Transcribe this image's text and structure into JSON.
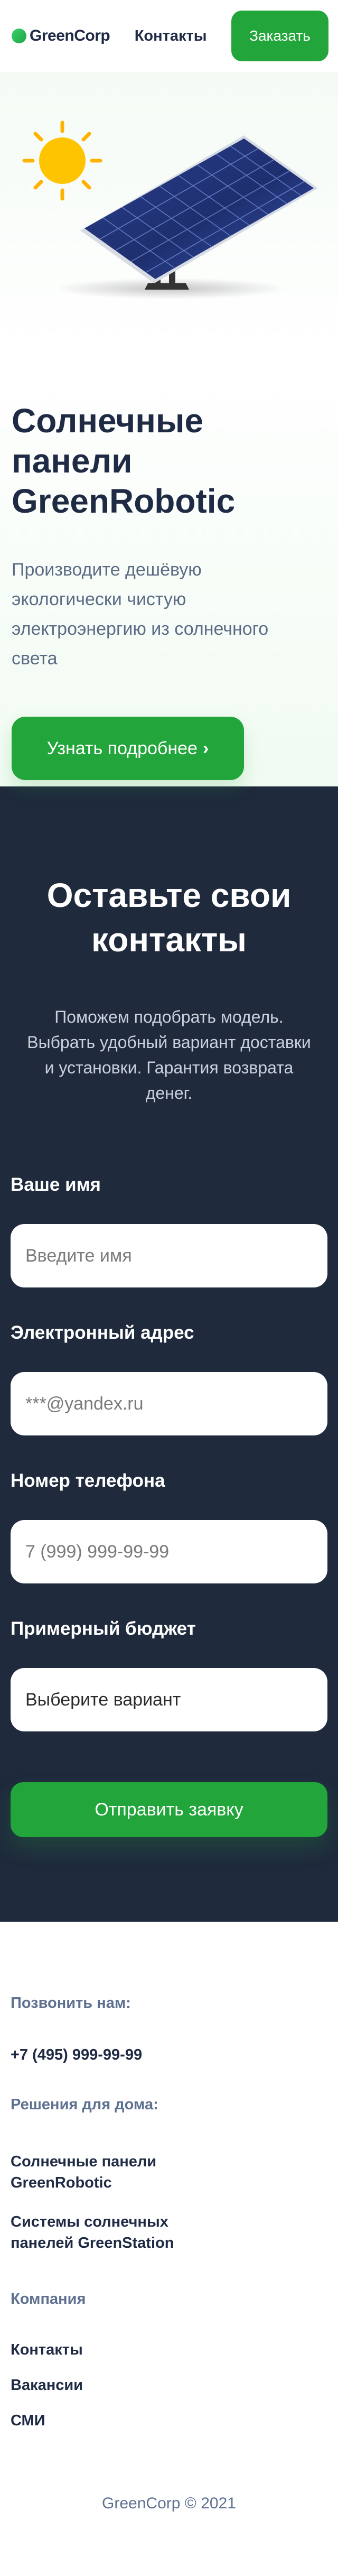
{
  "header": {
    "logo_text": "GreenCorp",
    "nav_contacts": "Контакты",
    "order_label": "Заказать"
  },
  "hero": {
    "title": "Солнечные панели GreenRobotic",
    "description": "Производите дешёвую экологически чистую электроэнергию из солнечного света",
    "cta_label": "Узнать подробнее",
    "cta_icon": "›"
  },
  "form_section": {
    "title": "Оставьте свои контакты",
    "subtitle": "Поможем подобрать модель. Выбрать удобный вариант доставки и установки. Гарантия возврата денег.",
    "fields": {
      "name": {
        "label": "Ваше имя",
        "placeholder": "Введите имя"
      },
      "email": {
        "label": "Электронный адрес",
        "placeholder": "***@yandex.ru"
      },
      "phone": {
        "label": "Номер телефона",
        "placeholder": "7 (999) 999-99-99"
      },
      "budget": {
        "label": "Примерный бюджет",
        "value": "Выберите вариант"
      }
    },
    "submit_label": "Отправить заявку"
  },
  "footer": {
    "call_heading": "Позвонить нам:",
    "phone": "+7 (495) 999-99-99",
    "home_heading": "Решения для дома:",
    "home_links": [
      "Солнечные панели GreenRobotic",
      "Системы солнечных панелей GreenStation"
    ],
    "company_heading": "Компания",
    "company_links": [
      "Контакты",
      "Вакансии",
      "СМИ"
    ],
    "copyright": "GreenCorp © 2021"
  },
  "colors": {
    "accent": "#22a63b",
    "dark": "#1f2a3d",
    "text": "#1f2a44",
    "muted": "#5e7191"
  }
}
